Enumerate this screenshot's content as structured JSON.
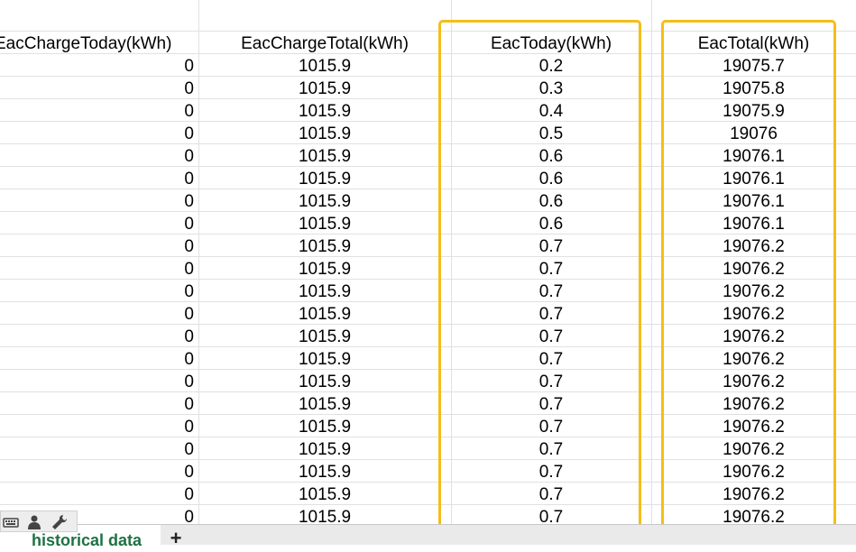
{
  "spreadsheet": {
    "columns": [
      "EacChargeToday(kWh)",
      "EacChargeTotal(kWh)",
      "EacToday(kWh)",
      "EacTotal(kWh)"
    ],
    "rows": [
      [
        "0",
        "1015.9",
        "0.2",
        "19075.7"
      ],
      [
        "0",
        "1015.9",
        "0.3",
        "19075.8"
      ],
      [
        "0",
        "1015.9",
        "0.4",
        "19075.9"
      ],
      [
        "0",
        "1015.9",
        "0.5",
        "19076"
      ],
      [
        "0",
        "1015.9",
        "0.6",
        "19076.1"
      ],
      [
        "0",
        "1015.9",
        "0.6",
        "19076.1"
      ],
      [
        "0",
        "1015.9",
        "0.6",
        "19076.1"
      ],
      [
        "0",
        "1015.9",
        "0.6",
        "19076.1"
      ],
      [
        "0",
        "1015.9",
        "0.7",
        "19076.2"
      ],
      [
        "0",
        "1015.9",
        "0.7",
        "19076.2"
      ],
      [
        "0",
        "1015.9",
        "0.7",
        "19076.2"
      ],
      [
        "0",
        "1015.9",
        "0.7",
        "19076.2"
      ],
      [
        "0",
        "1015.9",
        "0.7",
        "19076.2"
      ],
      [
        "0",
        "1015.9",
        "0.7",
        "19076.2"
      ],
      [
        "0",
        "1015.9",
        "0.7",
        "19076.2"
      ],
      [
        "0",
        "1015.9",
        "0.7",
        "19076.2"
      ],
      [
        "0",
        "1015.9",
        "0.7",
        "19076.2"
      ],
      [
        "0",
        "1015.9",
        "0.7",
        "19076.2"
      ],
      [
        "0",
        "1015.9",
        "0.7",
        "19076.2"
      ],
      [
        "0",
        "1015.9",
        "0.7",
        "19076.2"
      ],
      [
        "0",
        "1015.9",
        "0.7",
        "19076.2"
      ]
    ],
    "highlighted_columns": [
      "EacToday(kWh)",
      "EacTotal(kWh)"
    ]
  },
  "sheet_tabs": {
    "active": "historical data",
    "add_label": "+"
  },
  "toolbar_icons": [
    "keyboard-icon",
    "person-icon",
    "wrench-icon"
  ],
  "colors": {
    "highlight": "#f6bd16",
    "tab_text": "#1e7145",
    "gridline": "#e1e1e1"
  }
}
